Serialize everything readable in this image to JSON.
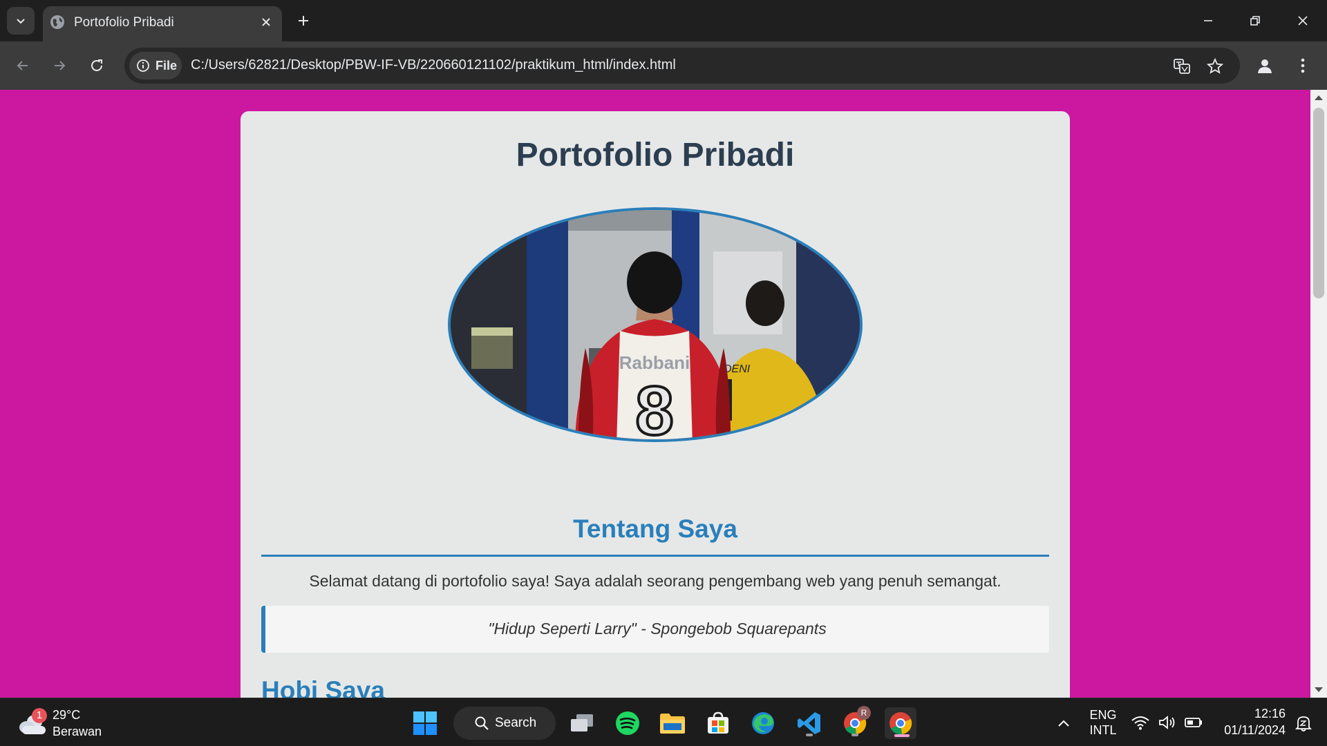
{
  "browser": {
    "tab_title": "Portofolio Pribadi",
    "site_chip_label": "File",
    "url": "C:/Users/62821/Desktop/PBW-IF-VB/220660121102/praktikum_html/index.html"
  },
  "page": {
    "title": "Portofolio Pribadi",
    "about_heading": "Tentang Saya",
    "intro": "Selamat datang di portofolio saya! Saya adalah seorang pengembang web yang penuh semangat.",
    "quote": "\"Hidup Seperti Larry\" - Spongebob Squarepants",
    "hobby_heading": "Hobi Saya",
    "photo": {
      "jersey_name": "Rabbani",
      "jersey_number": "8",
      "second_jersey_name": "DENI"
    },
    "colors": {
      "background": "#cc18a0",
      "card": "#e6e8e8",
      "title": "#2c3e50",
      "accent": "#2a7fba"
    }
  },
  "taskbar": {
    "weather_badge": "1",
    "weather_temp": "29°C",
    "weather_desc": "Berawan",
    "search_label": "Search",
    "language_top": "ENG",
    "language_bottom": "INTL",
    "time": "12:16",
    "date": "01/11/2024",
    "chrome_profile_badge": "R"
  }
}
